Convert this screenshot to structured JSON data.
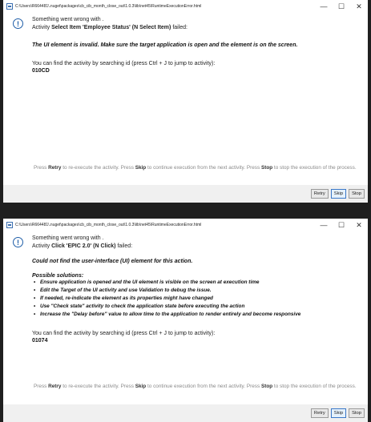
{
  "dialog1": {
    "title_path": "C:\\Users\\R664481\\.nuget\\packages\\cb_cib_month_close_out\\1.0.3\\lib\\net45\\RuntimeExecutionError.html",
    "message_line1": "Something went wrong with .",
    "activity_prefix": "Activity ",
    "activity_name": "Select Item 'Employee Status'",
    "activity_type": "(N Select Item)",
    "failed_suffix": "failed:",
    "error_text": "The UI element is invalid. Make sure the target application is open and the element is on the screen.",
    "search_text": "You can find the activity by searching id (press Ctrl + J to jump to activity):",
    "activity_id": "010CD",
    "footer": {
      "p1": "Press ",
      "retry": "Retry",
      "p2": " to re-execute the activity. Press ",
      "skip": "Skip",
      "p3": " to continue execution from the next activity. Press ",
      "stop": "Stop",
      "p4": " to stop the execution of the process."
    },
    "buttons": {
      "retry": "Retry",
      "skip": "Skip",
      "stop": "Stop"
    }
  },
  "dialog2": {
    "title_path": "C:\\Users\\R664481\\.nuget\\packages\\cb_cib_month_close_out\\1.0.3\\lib\\net45\\RuntimeExecutionError.html",
    "message_line1": "Something went wrong with .",
    "activity_prefix": "Activity ",
    "activity_name": "Click 'EPIC 2.0'",
    "activity_type": "(N Click)",
    "failed_suffix": "failed:",
    "error_text": "Could not find the user-interface (UI) element for this action.",
    "solutions_title": "Possible solutions:",
    "solutions": [
      "Ensure application is opened and the UI element is visible on the screen at execution time",
      "Edit the Target of the UI activity and use Validation to debug the issue.",
      "If needed, re-indicate the element as its properties might have changed",
      "Use \"Check state\" activity to check the application state before executing the action",
      "Increase the \"Delay before\" value to allow time to the application to render entirely and become responsive"
    ],
    "search_text": "You can find the activity by searching id (press Ctrl + J to jump to activity):",
    "activity_id": "01074",
    "footer": {
      "p1": "Press ",
      "retry": "Retry",
      "p2": " to re-execute the activity. Press ",
      "skip": "Skip",
      "p3": " to continue execution from the next activity. Press ",
      "stop": "Stop",
      "p4": " to stop the execution of the process."
    },
    "buttons": {
      "retry": "Retry",
      "skip": "Skip",
      "stop": "Stop"
    }
  },
  "window_controls": {
    "minimize": "—",
    "maximize": "☐",
    "close": "✕"
  },
  "icons": {
    "info": "info-icon",
    "app": "app-icon"
  },
  "colors": {
    "accent": "#1f5ea8",
    "footer_text": "#8a8a8a",
    "button_bar": "#f0f0f0"
  }
}
